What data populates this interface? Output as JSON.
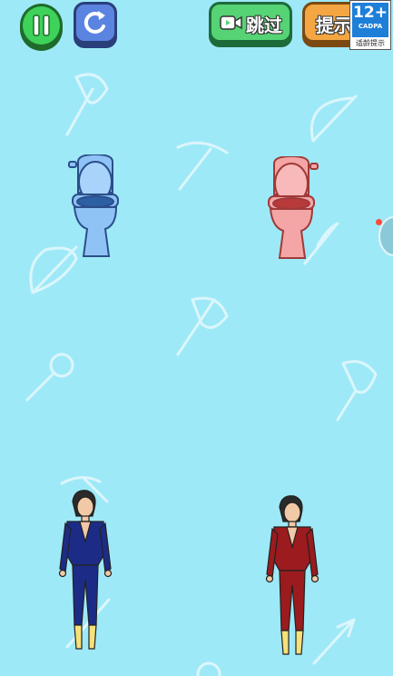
{
  "toolbar": {
    "pause": {
      "icon": "pause-icon",
      "color": "#3ed25a"
    },
    "restart": {
      "icon": "restart-icon",
      "color": "#5b84e0"
    },
    "skip": {
      "label": "跳过",
      "icon": "video-icon",
      "color": "#56d374"
    },
    "hint": {
      "label": "提示",
      "color": "#f4a642"
    }
  },
  "age_rating": {
    "rating": "12+",
    "org": "CADPA",
    "caption": "适龄提示",
    "color": "#1e7fd8"
  },
  "scene": {
    "background": "#9ee9f7",
    "toilets": [
      {
        "name": "blue-toilet",
        "color": "#8fc3f5"
      },
      {
        "name": "pink-toilet",
        "color": "#f4a6a6"
      }
    ],
    "characters": [
      {
        "name": "blue-character",
        "suit_color": "#1c2c86"
      },
      {
        "name": "red-character",
        "suit_color": "#9b1b1e"
      }
    ]
  }
}
